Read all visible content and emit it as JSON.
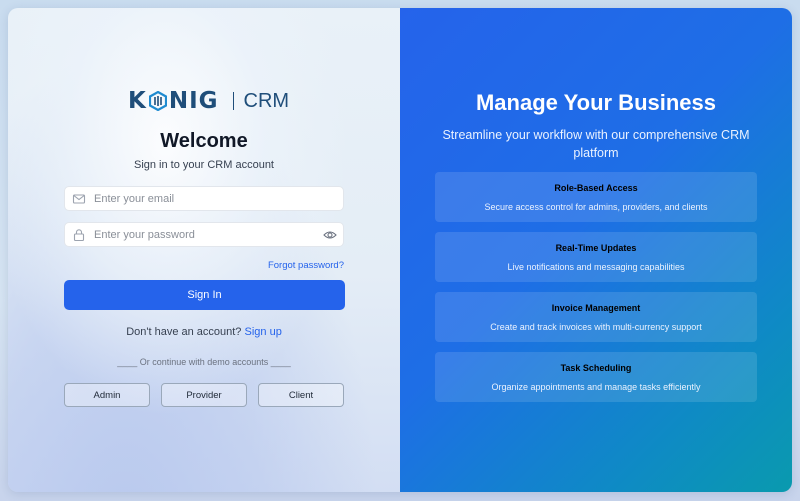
{
  "brand": {
    "name": "KONIG",
    "product": "CRM"
  },
  "login": {
    "title": "Welcome",
    "subtitle": "Sign in to your CRM account",
    "email_placeholder": "Enter your email",
    "password_placeholder": "Enter your password",
    "forgot": "Forgot password?",
    "signin_label": "Sign In",
    "no_account": "Don't have an account?",
    "signup": "Sign up",
    "demo_text": "____ Or continue with demo accounts ____",
    "demo_buttons": [
      "Admin",
      "Provider",
      "Client"
    ]
  },
  "promo": {
    "title": "Manage Your Business",
    "subtitle": "Streamline your workflow with our comprehensive CRM platform",
    "features": [
      {
        "title": "Role-Based Access",
        "desc": "Secure access control for admins, providers, and clients"
      },
      {
        "title": "Real-Time Updates",
        "desc": "Live notifications and messaging capabilities"
      },
      {
        "title": "Invoice Management",
        "desc": "Create and track invoices with multi-currency support"
      },
      {
        "title": "Task Scheduling",
        "desc": "Organize appointments and manage tasks efficiently"
      }
    ]
  },
  "colors": {
    "primary": "#2563eb",
    "logo": "#1f4e7a",
    "panel_gradient_end": "#0a9aae"
  }
}
